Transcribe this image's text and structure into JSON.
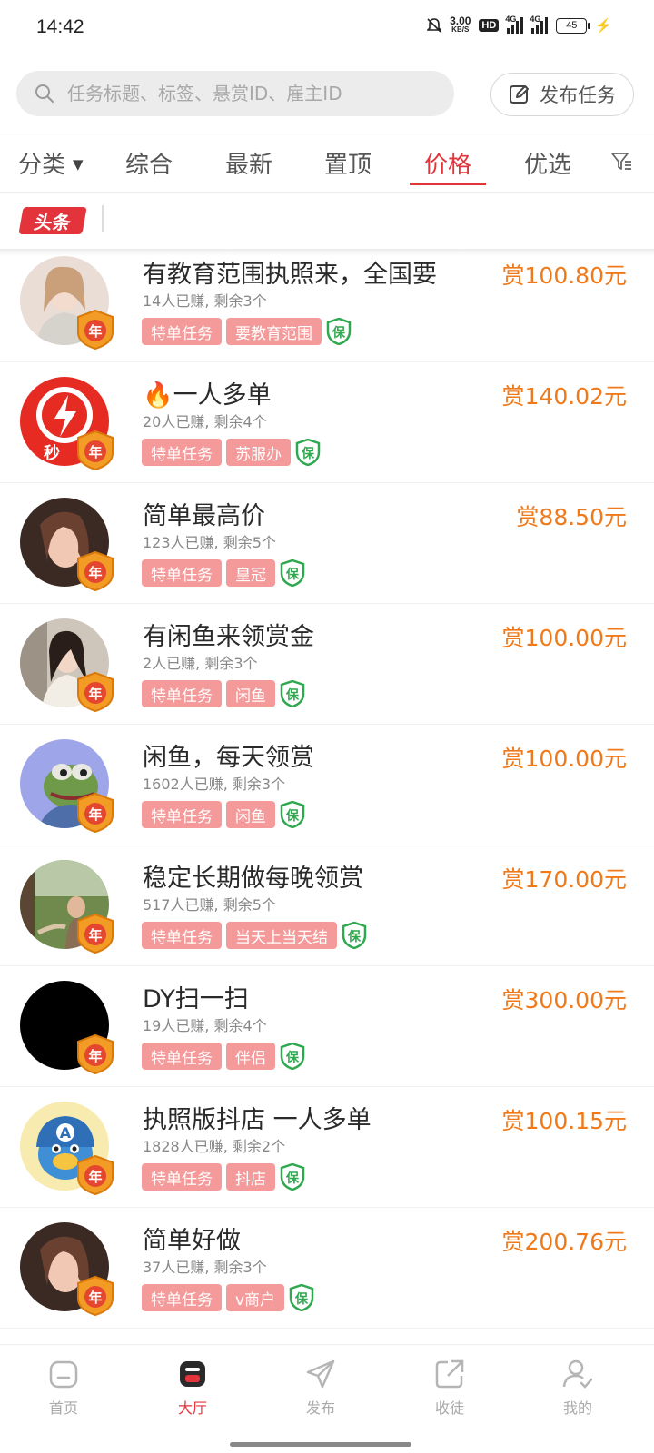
{
  "status_bar": {
    "time": "14:42",
    "net_speed": "3.00",
    "net_unit": "KB/S",
    "hd": "HD",
    "signal1": "4G",
    "signal2": "4G",
    "battery": "45"
  },
  "search": {
    "placeholder": "任务标题、标签、悬赏ID、雇主ID"
  },
  "publish_button": {
    "label": "发布任务"
  },
  "tabs": [
    {
      "label": "分类"
    },
    {
      "label": "综合"
    },
    {
      "label": "最新"
    },
    {
      "label": "置顶"
    },
    {
      "label": "价格",
      "active": true
    },
    {
      "label": "优选"
    }
  ],
  "headline": {
    "badge": "头条",
    "text": ""
  },
  "colors": {
    "accent": "#e3343c",
    "reward": "#f07a1a",
    "tag_bg": "#f59a9a",
    "guarantee": "#2fa84f"
  },
  "tasks": [
    {
      "title": "有教育范围执照来，全国要",
      "stats": "14人已赚, 剩余3个",
      "tags": [
        "特单任务",
        "要教育范围"
      ],
      "guarantee": "保",
      "year_badge": "年",
      "reward": "赏100.80元"
    },
    {
      "title": "🔥一人多单",
      "stats": "20人已赚, 剩余4个",
      "tags": [
        "特单任务",
        "苏服办"
      ],
      "guarantee": "保",
      "year_badge": "年",
      "reward": "赏140.02元",
      "avatar_text": "秒"
    },
    {
      "title": "简单最高价",
      "stats": "123人已赚, 剩余5个",
      "tags": [
        "特单任务",
        "皇冠"
      ],
      "guarantee": "保",
      "year_badge": "年",
      "reward": "赏88.50元"
    },
    {
      "title": "有闲鱼来领赏金",
      "stats": "2人已赚, 剩余3个",
      "tags": [
        "特单任务",
        "闲鱼"
      ],
      "guarantee": "保",
      "year_badge": "年",
      "reward": "赏100.00元"
    },
    {
      "title": "闲鱼，每天领赏",
      "stats": "1602人已赚, 剩余3个",
      "tags": [
        "特单任务",
        "闲鱼"
      ],
      "guarantee": "保",
      "year_badge": "年",
      "reward": "赏100.00元"
    },
    {
      "title": "稳定长期做每晚领赏",
      "stats": "517人已赚, 剩余5个",
      "tags": [
        "特单任务",
        "当天上当天结"
      ],
      "guarantee": "保",
      "year_badge": "年",
      "reward": "赏170.00元"
    },
    {
      "title": "DY扫一扫",
      "stats": "19人已赚, 剩余4个",
      "tags": [
        "特单任务",
        "伴侣"
      ],
      "guarantee": "保",
      "year_badge": "年",
      "reward": "赏300.00元"
    },
    {
      "title": "执照版抖店 一人多单",
      "stats": "1828人已赚, 剩余2个",
      "tags": [
        "特单任务",
        "抖店"
      ],
      "guarantee": "保",
      "year_badge": "年",
      "reward": "赏100.15元",
      "avatar_text": "A"
    },
    {
      "title": "简单好做",
      "stats": "37人已赚, 剩余3个",
      "tags": [
        "特单任务",
        "v商户"
      ],
      "guarantee": "保",
      "year_badge": "年",
      "reward": "赏200.76元"
    }
  ],
  "bottom_nav": [
    {
      "label": "首页",
      "icon": "home-icon"
    },
    {
      "label": "大厅",
      "icon": "hall-icon",
      "active": true
    },
    {
      "label": "发布",
      "icon": "send-icon"
    },
    {
      "label": "收徒",
      "icon": "share-icon"
    },
    {
      "label": "我的",
      "icon": "user-icon"
    }
  ]
}
